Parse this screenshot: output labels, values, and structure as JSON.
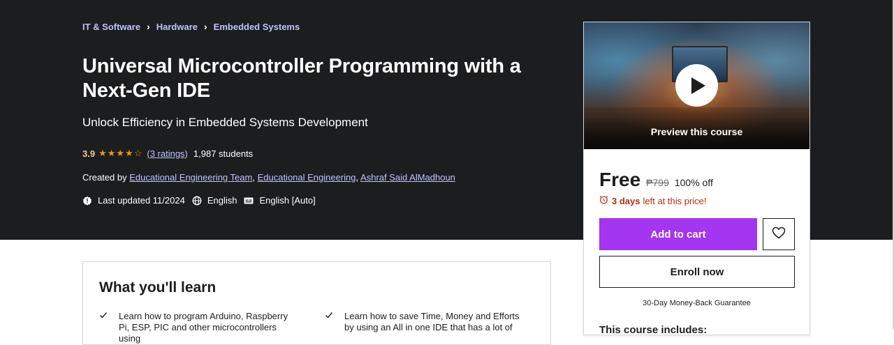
{
  "breadcrumb": {
    "items": [
      "IT & Software",
      "Hardware",
      "Embedded Systems"
    ],
    "separator": "›"
  },
  "course": {
    "title": "Universal Microcontroller Programming with a Next-Gen IDE",
    "subtitle": "Unlock Efficiency in Embedded Systems Development",
    "rating": "3.9",
    "stars": "★★★★☆",
    "ratings_link": "(3 ratings)",
    "students": "1,987 students",
    "created_by_label": "Created by",
    "authors": [
      "Educational Engineering Team",
      "Educational Engineering",
      "Ashraf Said AlMadhoun"
    ],
    "author_separator": ",",
    "last_updated": "Last updated 11/2024",
    "language": "English",
    "captions": "English [Auto]"
  },
  "card": {
    "preview_label": "Preview this course",
    "price": "Free",
    "original_price": "₱799",
    "discount": "100% off",
    "timer_days": "3 days",
    "timer_suffix": "left at this price!",
    "add_to_cart": "Add to cart",
    "enroll_now": "Enroll now",
    "guarantee": "30-Day Money-Back Guarantee",
    "includes_title": "This course includes:"
  },
  "learn": {
    "title": "What you'll learn",
    "items": [
      "Learn how to program Arduino, Raspberry Pi, ESP, PIC and other microcontrollers using",
      "Learn how to save Time, Money and Efforts by using an All in one IDE that has a lot of"
    ]
  },
  "colors": {
    "hero_bg": "#1c1d1f",
    "link": "#c0c4fc",
    "rating": "#f3ca8c",
    "star": "#e59819",
    "cta": "#a435f0",
    "timer": "#b32d0f"
  },
  "icons": [
    "chevron-right-icon",
    "star-icon",
    "alert-badge-icon",
    "globe-icon",
    "captions-icon",
    "play-icon",
    "alarm-clock-icon",
    "heart-icon",
    "checkmark-icon"
  ]
}
